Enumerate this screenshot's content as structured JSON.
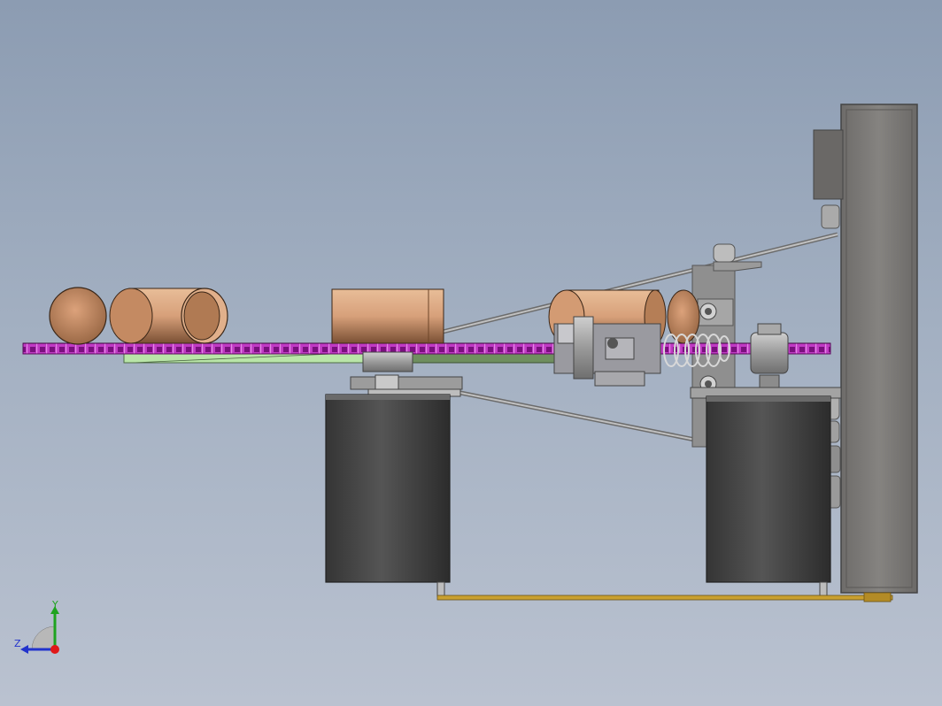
{
  "viewport": {
    "background_top": "#8c9cb2",
    "background_bottom": "#bac2d0"
  },
  "triad": {
    "y_label": "Y",
    "z_label": "Z",
    "y_color": "#1fa31f",
    "z_color": "#2233cc",
    "x_color": "#e01818"
  },
  "colors": {
    "copper": "#d9a27a",
    "chain": "#b21fb5",
    "motor": "#4a4a4a",
    "bracket": "#8e8e8e",
    "panel": "#7d7b78",
    "rod": "#c9a030",
    "guide": "#b7e3a4"
  }
}
